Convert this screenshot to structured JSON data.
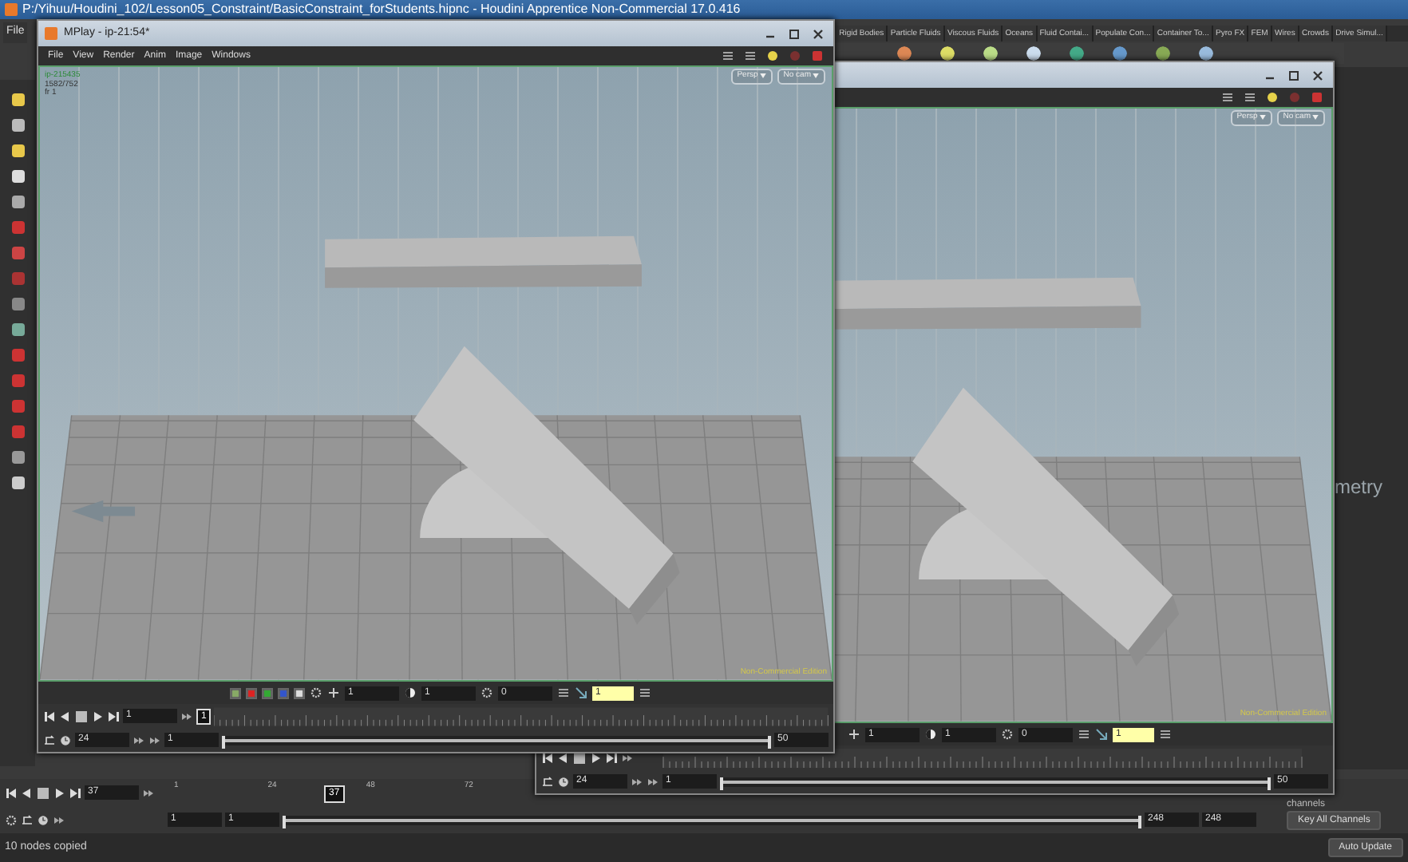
{
  "window": {
    "title": "P:/Yihuu/Houdini_102/Lesson05_Constraint/BasicConstraint_forStudents.hipnc - Houdini Apprentice Non-Commercial 17.0.416"
  },
  "main_menu": [
    "File"
  ],
  "shelf_tabs": [
    "Rigid Bodies",
    "Particle Fluids",
    "Viscous Fluids",
    "Oceans",
    "Fluid Contai...",
    "Populate Con...",
    "Container To...",
    "Pyro FX",
    "FEM",
    "Wires",
    "Crowds",
    "Drive Simul..."
  ],
  "mplay_windows": [
    {
      "title": "MPlay - ip-21:54*",
      "menu": [
        "File",
        "View",
        "Render",
        "Anim",
        "Image",
        "Windows"
      ],
      "viewport": {
        "info": [
          "ip-215435",
          "1582/752",
          "fr 1"
        ],
        "view_menus": [
          "Persp",
          "No cam"
        ],
        "edition": "Non-Commercial Edition"
      },
      "controls": {
        "fields": [
          "1",
          "1",
          "0"
        ],
        "highlight_value": "1"
      },
      "playback": {
        "frame": "1",
        "frame_marker": "1",
        "fps": "24",
        "range_start": "1",
        "range_end": "50",
        "level": 1
      }
    },
    {
      "viewport": {
        "view_menus": [
          "Persp",
          "No cam"
        ],
        "edition": "Non-Commercial Edition"
      },
      "controls": {
        "fields": [
          "1",
          "1",
          "0"
        ],
        "highlight_value": "1"
      },
      "playback": {
        "fps": "24",
        "range_start": "1",
        "range_end": "50",
        "level": 1
      }
    }
  ],
  "right_panel": {
    "partial_label": "metry",
    "channels_label": "channels",
    "key_button": "Key All Channels"
  },
  "timeline": {
    "frame": "37",
    "marker": "37",
    "ticks": [
      "1",
      "24",
      "48",
      "72"
    ],
    "range_start": "1",
    "range_start_2": "1",
    "range_end": "248",
    "range_end_2": "248",
    "level": 1
  },
  "status_bar": {
    "message": "10 nodes copied",
    "auto_update": "Auto Update"
  }
}
